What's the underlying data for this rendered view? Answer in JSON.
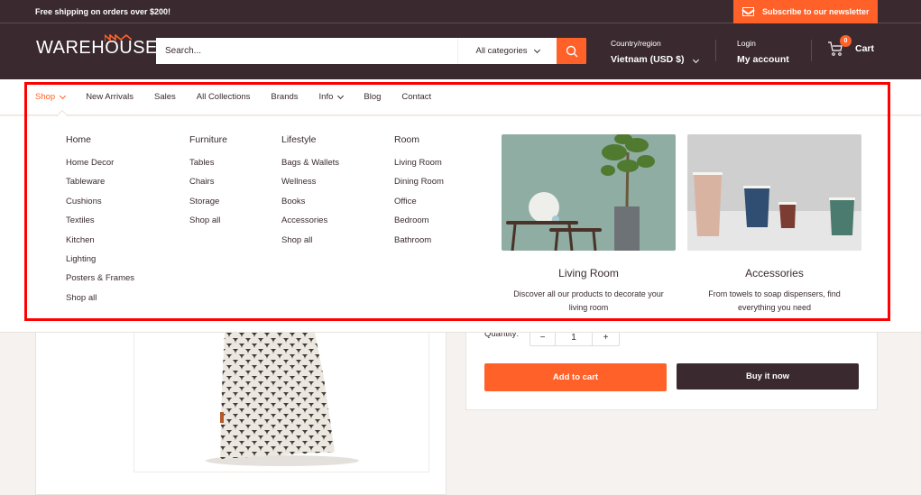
{
  "topbar": {
    "shipping_message": "Free shipping on orders over $200!",
    "newsletter_label": "Subscribe to our newsletter"
  },
  "header": {
    "logo_text": "WAREHOUSE",
    "search_placeholder": "Search...",
    "category_select": "All categories",
    "region_label": "Country/region",
    "region_value": "Vietnam (USD $)",
    "login_label": "Login",
    "account_label": "My account",
    "cart_label": "Cart",
    "cart_count": "0"
  },
  "nav": {
    "items": [
      {
        "label": "Shop",
        "active": true,
        "dropdown": true
      },
      {
        "label": "New Arrivals"
      },
      {
        "label": "Sales"
      },
      {
        "label": "All Collections"
      },
      {
        "label": "Brands"
      },
      {
        "label": "Info",
        "dropdown": true
      },
      {
        "label": "Blog"
      },
      {
        "label": "Contact"
      }
    ]
  },
  "mega_menu": {
    "columns": [
      {
        "title": "Home",
        "links": [
          "Home Decor",
          "Tableware",
          "Cushions",
          "Textiles",
          "Kitchen",
          "Lighting",
          "Posters & Frames",
          "Shop all"
        ]
      },
      {
        "title": "Furniture",
        "links": [
          "Tables",
          "Chairs",
          "Storage",
          "Shop all"
        ]
      },
      {
        "title": "Lifestyle",
        "links": [
          "Bags & Wallets",
          "Wellness",
          "Books",
          "Accessories",
          "Shop all"
        ]
      },
      {
        "title": "Room",
        "links": [
          "Living Room",
          "Dining Room",
          "Office",
          "Bedroom",
          "Bathroom"
        ]
      }
    ],
    "promos": [
      {
        "title": "Living Room",
        "description": "Discover all our products to decorate your living room"
      },
      {
        "title": "Accessories",
        "description": "From towels to soap dispensers, find everything you need"
      }
    ]
  },
  "product": {
    "quantity_label": "Quantity:",
    "quantity_value": "1",
    "minus": "−",
    "plus": "+",
    "add_to_cart": "Add to cart",
    "buy_now": "Buy it now"
  },
  "colors": {
    "brand_dark": "#3a2a30",
    "accent": "#ff6128",
    "highlight": "#ff0000"
  }
}
